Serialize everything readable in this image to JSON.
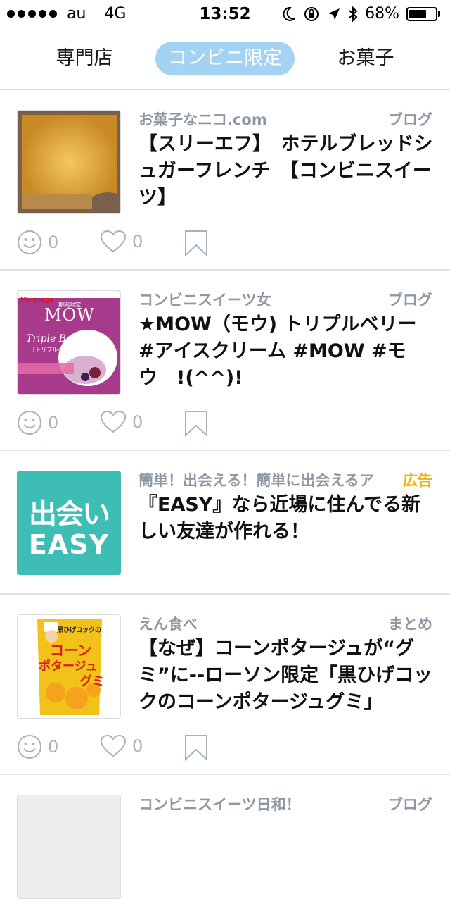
{
  "status_bar": {
    "carrier": "au",
    "network": "4G",
    "time": "13:52",
    "battery": "68%",
    "battery_level": 0.68
  },
  "tabs": [
    {
      "label": "専門店",
      "active": false
    },
    {
      "label": "コンビニ限定",
      "active": true
    },
    {
      "label": "お菓子",
      "active": false
    }
  ],
  "feed": [
    {
      "source": "お菓子なニコ.com",
      "kind": "ブログ",
      "title": "【スリーエフ】　ホテルブレッドシュガーフレンチ　【コンビニスイーツ】",
      "smile_count": "0",
      "like_count": "0"
    },
    {
      "source": "コンビニスイーツ女",
      "kind": "ブログ",
      "title": "★MOW（モウ) トリプルベリー #アイスクリーム #MOW #モウ　!(^^)!",
      "smile_count": "0",
      "like_count": "0",
      "thumb_text": {
        "brand": "Morinaga",
        "limited": "期間限定",
        "logo": "MOW",
        "flavor": "Triple Berry",
        "flavor_jp": "[トリプルベリー]"
      }
    },
    {
      "source": "簡単！出会える！簡単に出会えるア",
      "kind": "広告",
      "title": "『EASY』なら近場に住んでる新しい友達が作れる！",
      "thumb_text": {
        "line1": "出会い",
        "line2": "EASY"
      },
      "thumb_color": "#3dbdb3"
    },
    {
      "source": "えん食べ",
      "kind": "まとめ",
      "title": "【なぜ】コーンポタージュが“グミ”に--ローソン限定「黒ひげコックのコーンポタージュグミ」",
      "smile_count": "0",
      "like_count": "0",
      "thumb_text": {
        "top": "黒ひげコックの",
        "main1": "コーン",
        "main2": "ポタージュ",
        "main3": "グミ"
      }
    },
    {
      "source": "コンビニスイーツ日和！",
      "kind": "ブログ"
    }
  ],
  "icons": {
    "smile": "smile-icon",
    "heart": "heart-icon",
    "bookmark": "bookmark-icon"
  },
  "colors": {
    "active_tab": "#a3d2f3",
    "meta_text": "#8e98a4",
    "ad_label": "#f0b400",
    "action_icon": "#a6b2be"
  }
}
